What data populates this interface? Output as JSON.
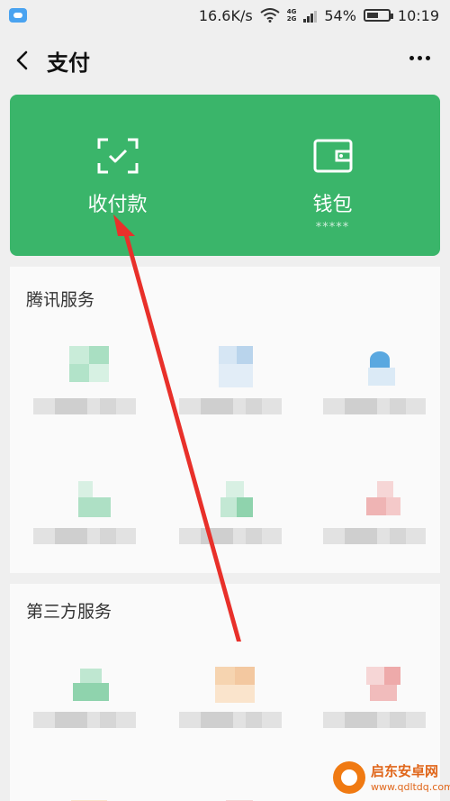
{
  "status_bar": {
    "network_speed": "16.6K/s",
    "network_type": "4G",
    "network_type_2": "2G",
    "battery_percent": "54%",
    "battery_level": 0.54,
    "time": "10:19"
  },
  "header": {
    "title": "支付"
  },
  "payment_card": {
    "background_color": "#3ab56a",
    "receive_pay_label": "收付款",
    "wallet_label": "钱包",
    "wallet_balance_masked": "*****"
  },
  "sections": {
    "tencent_services": {
      "title": "腾讯服务"
    },
    "third_party_services": {
      "title": "第三方服务"
    }
  },
  "annotation": {
    "arrow_color": "#e8302a"
  },
  "watermark": {
    "name": "启东安卓网",
    "url": "www.qdltdq.com"
  }
}
